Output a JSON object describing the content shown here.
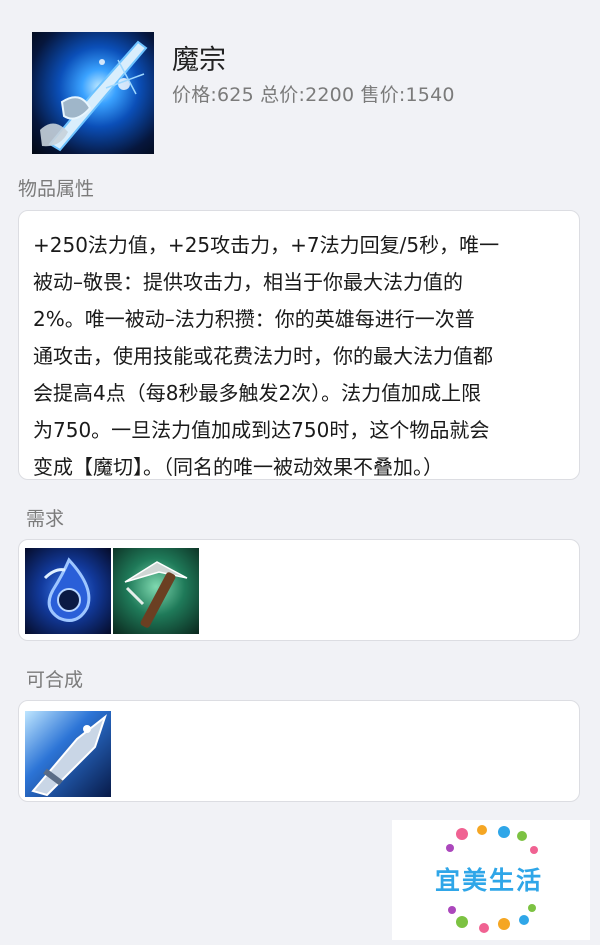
{
  "item": {
    "name": "魔宗",
    "price_line": "价格:625 总价:2200 售价:1540",
    "icon": "glowing-blue-blade-icon"
  },
  "sections": {
    "attributes_title": "物品属性",
    "description": "+250法力值，+25攻击力，+7法力回复/5秒，唯一\n被动–敬畏：提供攻击力，相当于你最大法力值的\n2%。唯一被动–法力积攒：你的英雄每进行一次普\n通攻击，使用技能或花费法力时，你的最大法力值都\n会提高4点（每8秒最多触发2次）。法力值加成上限\n为750。一旦法力值加成到达750时，这个物品就会\n变成【魔切】。（同名的唯一被动效果不叠加。）",
    "requires_title": "需求",
    "requires_items": [
      "tear-of-the-goddess-icon",
      "pickaxe-icon"
    ],
    "builds_into_title": "可合成",
    "builds_into_items": [
      "blue-blade-sword-icon"
    ]
  },
  "watermark": {
    "text": "宜美生活",
    "colors": [
      "#2fa6e8",
      "#f06292",
      "#7cc242",
      "#f5a623"
    ]
  }
}
